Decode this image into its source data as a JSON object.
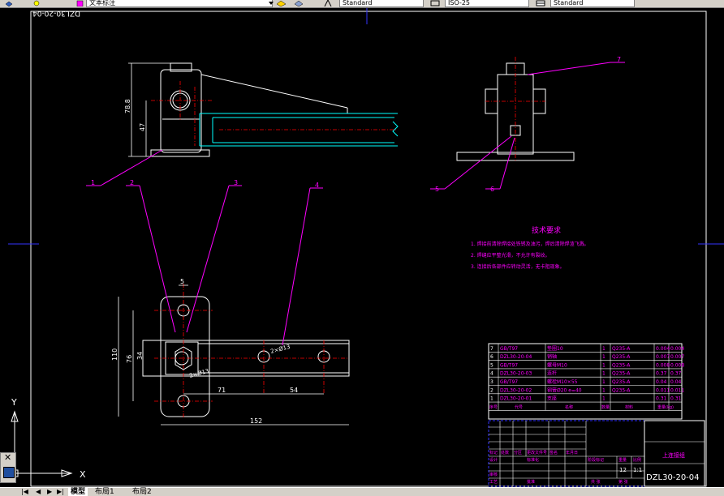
{
  "toolbar": {
    "text_style_combo": "文本标注",
    "style_combo_1": "Standard",
    "dim_style_combo": "ISO-25",
    "table_style_combo": "Standard"
  },
  "drawing": {
    "drawing_number_top": "DZL30-20-04",
    "dims": {
      "d_height_total": "78.8",
      "d_height_axis": "47",
      "d_width_5": "5",
      "d_plan_height": "110",
      "d_plan_mid": "76",
      "d_plan_inner": "34",
      "d_angle": "2×Ø13",
      "d_dia_hole": "2×Ø13",
      "d_71": "71",
      "d_54": "54",
      "d_152": "152"
    },
    "balloons": [
      "1",
      "2",
      "3",
      "4",
      "5",
      "6",
      "7"
    ]
  },
  "tech_req": {
    "title": "技术要求",
    "items": [
      "1. 焊接前清除焊接处铁锈及油污，焊后清除焊渣飞溅。",
      "2. 焊缝应平整光滑，不允许有裂纹。",
      "3. 连接后各部件应转动灵活，无卡阻现象。"
    ]
  },
  "bom": {
    "rows": [
      {
        "no": "7",
        "code": "GB/T97",
        "name": "垫圈10",
        "qty": "1",
        "mat": "Q235-A",
        "w1": "0.004",
        "w2": "0.004"
      },
      {
        "no": "6",
        "code": "DZL30-20-04",
        "name": "销轴",
        "qty": "1",
        "mat": "Q235-A",
        "w1": "0.007",
        "w2": "0.007"
      },
      {
        "no": "5",
        "code": "GB/T97",
        "name": "螺母M10",
        "qty": "1",
        "mat": "Q235-A",
        "w1": "0.008",
        "w2": "0.008"
      },
      {
        "no": "4",
        "code": "DZL30-20-03",
        "name": "连杆",
        "qty": "1",
        "mat": "Q235-A",
        "w1": "0.37",
        "w2": "0.37"
      },
      {
        "no": "3",
        "code": "GB/T97",
        "name": "螺栓M10×55",
        "qty": "1",
        "mat": "Q235-A",
        "w1": "0.04",
        "w2": "0.04"
      },
      {
        "no": "2",
        "code": "DZL30-20-02",
        "name": "钢管Ø20  e=40",
        "qty": "1",
        "mat": "Q235-A",
        "w1": "0.011",
        "w2": "0.011"
      },
      {
        "no": "1",
        "code": "DZL30-20-01",
        "name": "支座",
        "qty": "1",
        "mat": "",
        "w1": "0.31",
        "w2": "0.31"
      }
    ],
    "header": {
      "no": "序号",
      "code": "代号",
      "name": "名称",
      "qty": "数量",
      "mat": "材料",
      "weight": "重量(kg)"
    }
  },
  "title_block": {
    "part_name": "上连接组",
    "drawing_number": "DZL30-20-04",
    "scale": "1:1",
    "sheet_qty": "12",
    "labels": {
      "mark": "标记",
      "count": "处数",
      "zone": "分区",
      "change_doc": "更改文件号",
      "sign": "签名",
      "date": "年月日",
      "design": "设计",
      "standardize": "标准化",
      "stage_mark": "阶段标记",
      "weight": "重量",
      "scale": "比例",
      "audit": "审核",
      "process": "工艺",
      "approve": "批准",
      "sheet_total": "共 张",
      "sheet_no": "第 张"
    }
  },
  "ucs": {
    "x_label": "X",
    "y_label": "Y"
  },
  "tabs": {
    "model": "模型",
    "layout1": "布局1",
    "layout2": "布局2"
  },
  "colors": {
    "line_white": "#ffffff",
    "magenta": "#ff00ff",
    "cyan": "#00ffff",
    "red": "#ff0000",
    "blue": "#3333ff",
    "yellow": "#ffff00"
  }
}
